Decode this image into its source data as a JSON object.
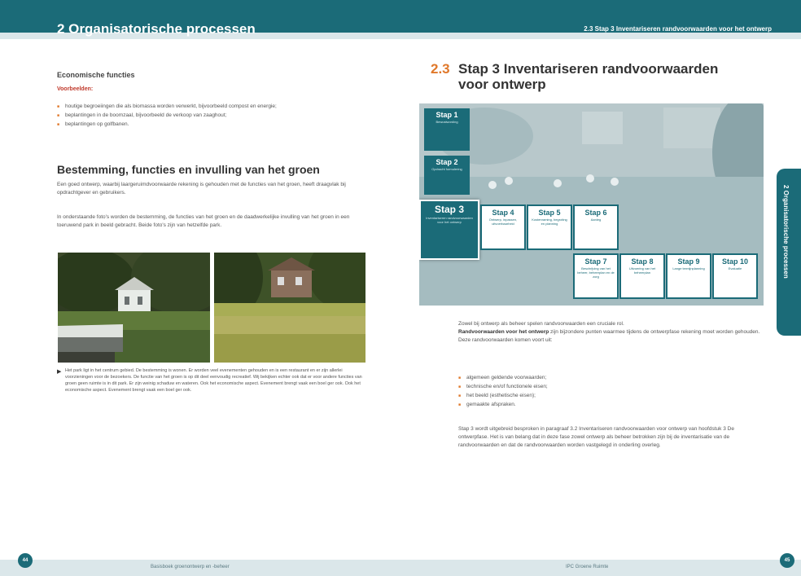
{
  "header": {
    "chapter_title": "2  Organisatorische processen",
    "section_header": "2.3  Stap 3  Inventariseren randvoorwaarden voor het ontwerp"
  },
  "left": {
    "econ_heading": "Economische functies",
    "examples_label": "Voorbeelden:",
    "bullets": [
      "houtige begroeiingen die als biomassa worden verwerkt, bijvoorbeeld compost en energie;",
      "beplantingen in de boomzaal, bijvoorbeeld de verkoop van zaaghout;",
      "beplantingen op golfbanen."
    ],
    "section_heading": "Bestemming, functies en invulling van het groen",
    "para1": "Een goed ontwerp, waarbij laargeruimdvoorwaarde rekening is gehouden met de functies van het groen, heeft draagvlak bij opdrachtgever en gebruikers.",
    "para2": "In onderstaande foto's worden de bestemming, de functies van het groen en de daadwerkelijke invulling van het groen in een toeruwend park in beeld gebracht. Beide foto's zijn van hetzelfde park.",
    "caption_arrow": "▶",
    "caption": "Het park ligt in het centrum gebied. De bestemming is wonen. Er worden veel evenementen gehouden en is een restaurant en er zijn allerlei voorzieningen voor de bezoekers. De functie van het groen is op dit deel eenvoudig recreatief. Wij bekijken echter ook dat er voor andere functies van groen geen ruimte is in dit park. Er zijn weinig schaduw en wateren. Ook het economische aspect. Evenement brengt vaak een boel ger ook. Ook het economische aspect. Evenement brengt vaak een boel ger ook."
  },
  "right": {
    "section_number": "2.3",
    "section_title": "Stap 3  Inventariseren randvoorwaarden voor ontwerp",
    "steps": [
      {
        "label": "Stap 1",
        "sub": "Bewustwording"
      },
      {
        "label": "Stap 2",
        "sub": "Opdracht formulering"
      },
      {
        "label": "Stap 3",
        "sub": "Inventariseren randvoorwaarden voor het ontwerp"
      },
      {
        "label": "Stap 4",
        "sub": "Ontwerp, inpassen, uitvoerbaarheid"
      },
      {
        "label": "Stap 5",
        "sub": "Kostenraming, begroting en planning"
      },
      {
        "label": "Stap 6",
        "sub": "Aanleg"
      },
      {
        "label": "Stap 7",
        "sub": "Beschrijving van het beheer, beheerplan en de zorg"
      },
      {
        "label": "Stap 8",
        "sub": "Uitvoering van het beheerplan"
      },
      {
        "label": "Stap 9",
        "sub": "Lange termijnplanning"
      },
      {
        "label": "Stap 10",
        "sub": "Evaluatie"
      }
    ],
    "intro": "Zowel bij ontwerp als beheer spelen randvoorwaarden een cruciale rol.",
    "bold_term": "Randvoorwaarden voor het ontwerp",
    "def_rest": " zijn bijzondere punten waarmee tijdens de ontwerpfase rekening moet worden gehouden.",
    "sub_intro": "Deze randvoorwaarden komen voort uit:",
    "bullets": [
      "algemeen geldende voorwaarden;",
      "technische en/of functionele eisen;",
      "het beeld (esthetische eisen);",
      "gemaakte afspraken."
    ],
    "closing": "Stap 3 wordt uitgebreid besproken in paragraaf 3.2 Inventariseren randvoorwaarden voor ontwerp van hoofdstuk 3 De ontwerpfase. Het is van belang dat in deze fase zowel ontwerp als beheer betrokken zijn bij de inventarisatie van de randvoorwaarden en dat de randvoorwaarden worden vastgelegd in onderling overleg."
  },
  "side_tab": "2 Organisatorische processen",
  "footer": {
    "left_page": "44",
    "right_page": "45",
    "left_text": "Basisboek groenontwerp en -beheer",
    "right_text": "IPC Groene Ruimte"
  },
  "colors": {
    "brand_teal": "#1b6b78",
    "accent_orange": "#e0782a"
  }
}
